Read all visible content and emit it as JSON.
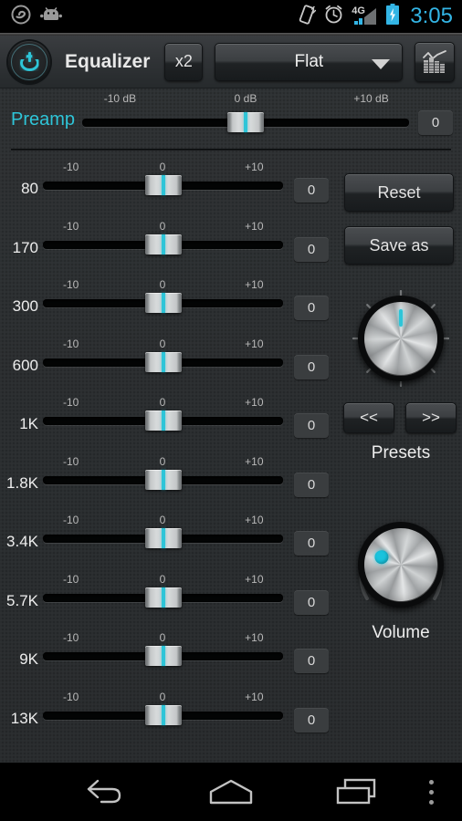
{
  "status_bar": {
    "icons_left": [
      "app-notification-icon",
      "android-robot-icon"
    ],
    "icons_right": [
      "vibrate-icon",
      "alarm-icon",
      "signal-4g-icon",
      "battery-charging-icon"
    ],
    "network_label": "4G",
    "clock": "3:05"
  },
  "header": {
    "power_icon": "power-icon",
    "title": "Equalizer",
    "multiplier_label": "x2",
    "preset_selected": "Flat",
    "caret_icon": "chevron-down-icon",
    "spectrum_icon": "spectrum-analyzer-icon"
  },
  "preamp": {
    "label": "Preamp",
    "scale": [
      "-10 dB",
      "0 dB",
      "+10 dB"
    ],
    "value": "0",
    "position_percent": 50
  },
  "band_scale": [
    "-10",
    "0",
    "+10"
  ],
  "bands": [
    {
      "name": "80",
      "value": "0",
      "position_percent": 50
    },
    {
      "name": "170",
      "value": "0",
      "position_percent": 50
    },
    {
      "name": "300",
      "value": "0",
      "position_percent": 50
    },
    {
      "name": "600",
      "value": "0",
      "position_percent": 50
    },
    {
      "name": "1K",
      "value": "0",
      "position_percent": 50
    },
    {
      "name": "1.8K",
      "value": "0",
      "position_percent": 50
    },
    {
      "name": "3.4K",
      "value": "0",
      "position_percent": 50
    },
    {
      "name": "5.7K",
      "value": "0",
      "position_percent": 50
    },
    {
      "name": "9K",
      "value": "0",
      "position_percent": 50
    },
    {
      "name": "13K",
      "value": "0",
      "position_percent": 50
    }
  ],
  "right_panel": {
    "reset_label": "Reset",
    "save_as_label": "Save as",
    "presets_label": "Presets",
    "presets_prev_label": "<<",
    "presets_next_label": ">>",
    "presets_knob_angle_deg": 0,
    "volume_label": "Volume",
    "volume_knob_angle_deg": -38
  },
  "nav_bar": {
    "back_icon": "back-arrow-icon",
    "home_icon": "home-icon",
    "recents_icon": "recent-apps-icon",
    "menu_icon": "overflow-menu-icon"
  },
  "colors": {
    "accent": "#2ec5d8",
    "clock": "#33b5e5",
    "surface": "#2b2e30",
    "header": "#303336",
    "text": "#ededed"
  }
}
